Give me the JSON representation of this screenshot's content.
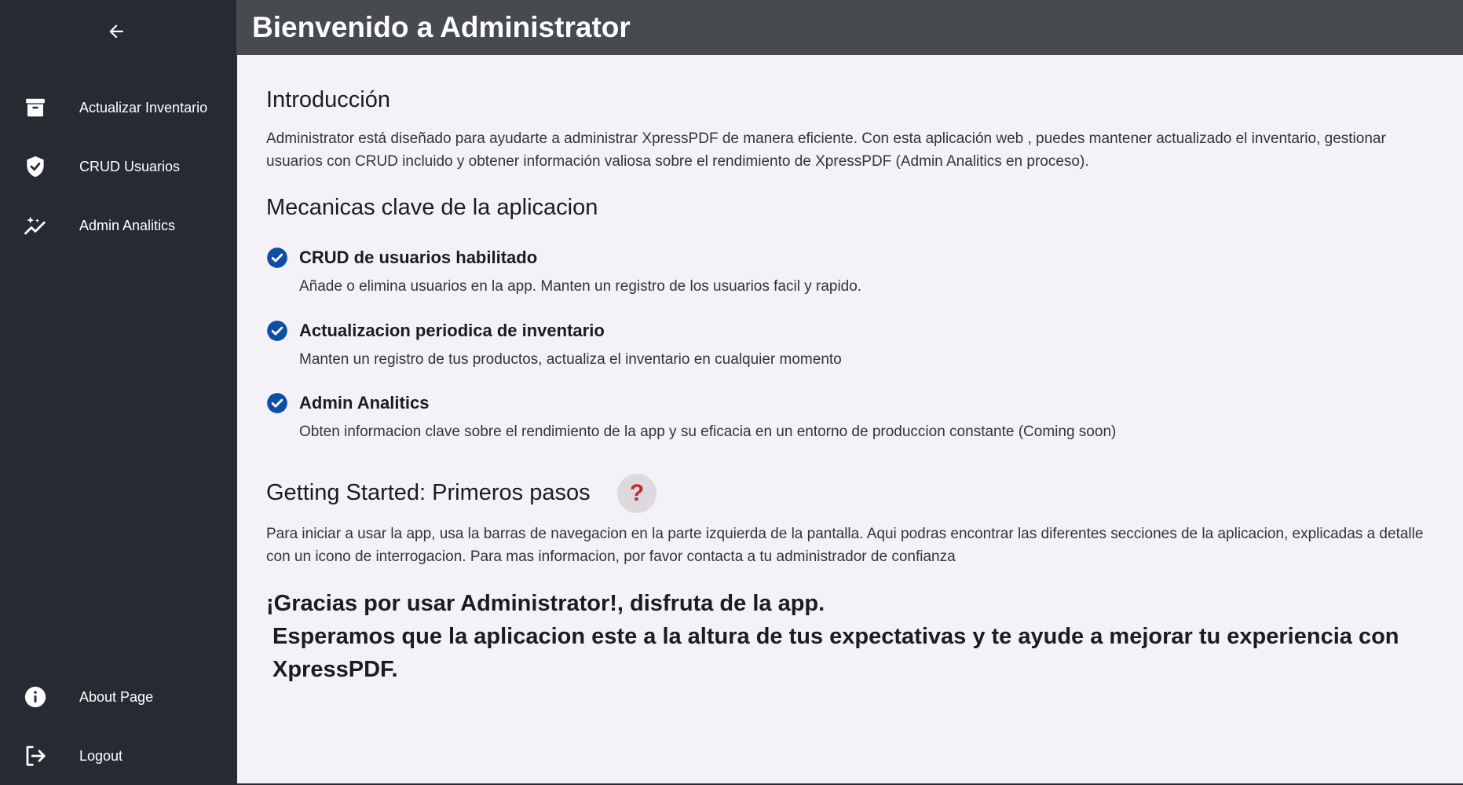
{
  "sidebar": {
    "back_icon": "arrow-left-icon",
    "items": [
      {
        "label": "Actualizar Inventario",
        "icon": "archive-icon"
      },
      {
        "label": "CRUD Usuarios",
        "icon": "shield-check-icon"
      },
      {
        "label": "Admin Analitics",
        "icon": "analytics-sparkle-icon"
      }
    ],
    "bottom_items": [
      {
        "label": "About Page",
        "icon": "info-icon"
      },
      {
        "label": "Logout",
        "icon": "logout-icon"
      }
    ]
  },
  "header": {
    "title": "Bienvenido a Administrator"
  },
  "intro": {
    "heading": "Introducción",
    "text": "Administrator está diseñado para ayudarte a administrar XpressPDF de manera eficiente. Con esta aplicación web , puedes mantener actualizado el inventario, gestionar usuarios con CRUD incluido y obtener información valiosa sobre el rendimiento de XpressPDF (Admin Analitics en proceso)."
  },
  "mechanics": {
    "heading": "Mecanicas clave de la aplicacion",
    "features": [
      {
        "title": "CRUD de usuarios habilitado",
        "description": "Añade o elimina usuarios en la app. Manten un registro de los usuarios facil y rapido."
      },
      {
        "title": "Actualizacion periodica de inventario",
        "description": "Manten un registro de tus productos, actualiza el inventario en cualquier momento"
      },
      {
        "title": "Admin Analitics",
        "description": "Obten informacion clave sobre el rendimiento de la app y su eficacia en un entorno de produccion constante (Coming soon)"
      }
    ]
  },
  "getting_started": {
    "heading": "Getting Started: Primeros pasos",
    "help_symbol": "?",
    "text": "Para iniciar a usar la app, usa la barras de navegacion en la parte izquierda de la pantalla. Aqui podras encontrar las diferentes secciones de la aplicacion, explicadas a detalle con un icono de interrogacion. Para mas informacion, por favor contacta a tu administrador de confianza"
  },
  "thanks": {
    "line1": "¡Gracias por usar Administrator!, disfruta de la app.",
    "line2": "Esperamos que la aplicacion este a la altura de tus expectativas y te ayude a mejorar tu experiencia con XpressPDF."
  },
  "colors": {
    "sidebar_bg": "#262b33",
    "header_bg": "#474b50",
    "content_bg": "#f4f1f7",
    "check_blue": "#0d4ea6",
    "help_red": "#c62828"
  }
}
